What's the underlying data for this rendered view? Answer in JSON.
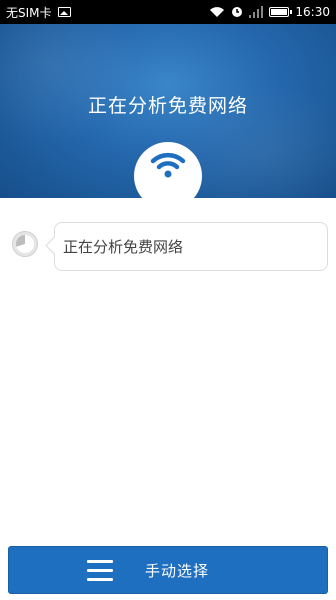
{
  "status_bar": {
    "carrier": "无SIM卡",
    "time": "16:30",
    "icons": [
      "image-icon",
      "wifi-icon",
      "alarm-icon",
      "signal-icon",
      "battery-icon"
    ]
  },
  "header": {
    "title": "正在分析免费网络",
    "background_color": "#2568ad",
    "icon": "wifi-icon"
  },
  "log": {
    "message": "正在分析免费网络"
  },
  "footer": {
    "button_label": "手动选择",
    "button_icon": "menu-icon",
    "button_color": "#1f6fc1"
  }
}
